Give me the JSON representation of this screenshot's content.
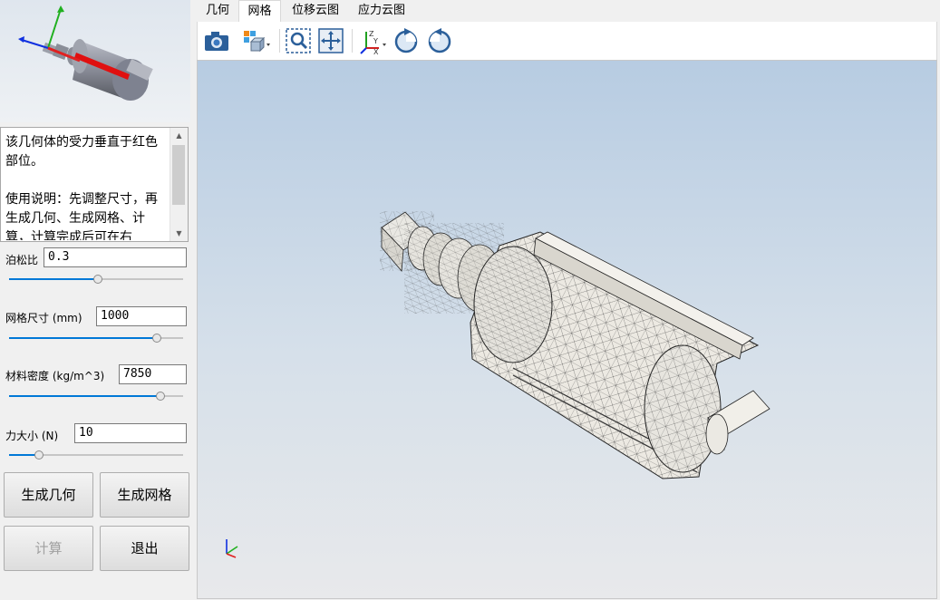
{
  "description": {
    "text": "该几何体的受力垂直于红色部位。\n\n使用说明：先调整尺寸，再生成几何、生成网格、计算，计算完成后可在右"
  },
  "params": {
    "poisson": {
      "label": "泊松比",
      "value": "0.3",
      "slider_fraction": 0.51
    },
    "mesh_size": {
      "label": "网格尺寸 (mm)",
      "value": "1000",
      "slider_fraction": 0.85
    },
    "density": {
      "label": "材料密度 (kg/m^3)",
      "value": "7850",
      "slider_fraction": 0.87
    },
    "force": {
      "label": "力大小 (N)",
      "value": "10",
      "slider_fraction": 0.17
    }
  },
  "buttons": {
    "gen_geometry": "生成几何",
    "gen_mesh": "生成网格",
    "compute": "计算",
    "exit": "退出"
  },
  "tabs": [
    {
      "label": "几何",
      "active": false
    },
    {
      "label": "网格",
      "active": true
    },
    {
      "label": "位移云图",
      "active": false
    },
    {
      "label": "应力云图",
      "active": false
    }
  ],
  "toolbar": {
    "buttons": [
      "camera-icon",
      "view-cube-icon",
      "zoom-window-icon",
      "fit-all-icon",
      "axis-orientation-icon",
      "rotate-cw-icon",
      "rotate-ccw-icon"
    ]
  },
  "colors": {
    "accent": "#0078d7",
    "load_highlight": "#e01010",
    "axis_x": "#e02020",
    "axis_y": "#20b020",
    "axis_z": "#1030e0"
  }
}
